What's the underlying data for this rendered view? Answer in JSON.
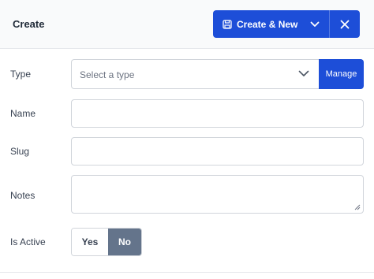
{
  "header": {
    "title": "Create",
    "create_new_label": "Create & New"
  },
  "form": {
    "type": {
      "label": "Type",
      "placeholder": "Select a type",
      "manage_label": "Manage"
    },
    "name": {
      "label": "Name",
      "value": ""
    },
    "slug": {
      "label": "Slug",
      "value": ""
    },
    "notes": {
      "label": "Notes",
      "value": ""
    },
    "is_active": {
      "label": "Is Active",
      "yes_label": "Yes",
      "no_label": "No",
      "selected": "No"
    }
  },
  "colors": {
    "primary": "#1d4ed8",
    "selected_toggle": "#64748b",
    "header_bg": "#f9fafb",
    "border": "#d1d5db"
  },
  "icons": [
    "save-icon",
    "chevron-down-icon",
    "close-icon",
    "resize-grip-icon"
  ]
}
